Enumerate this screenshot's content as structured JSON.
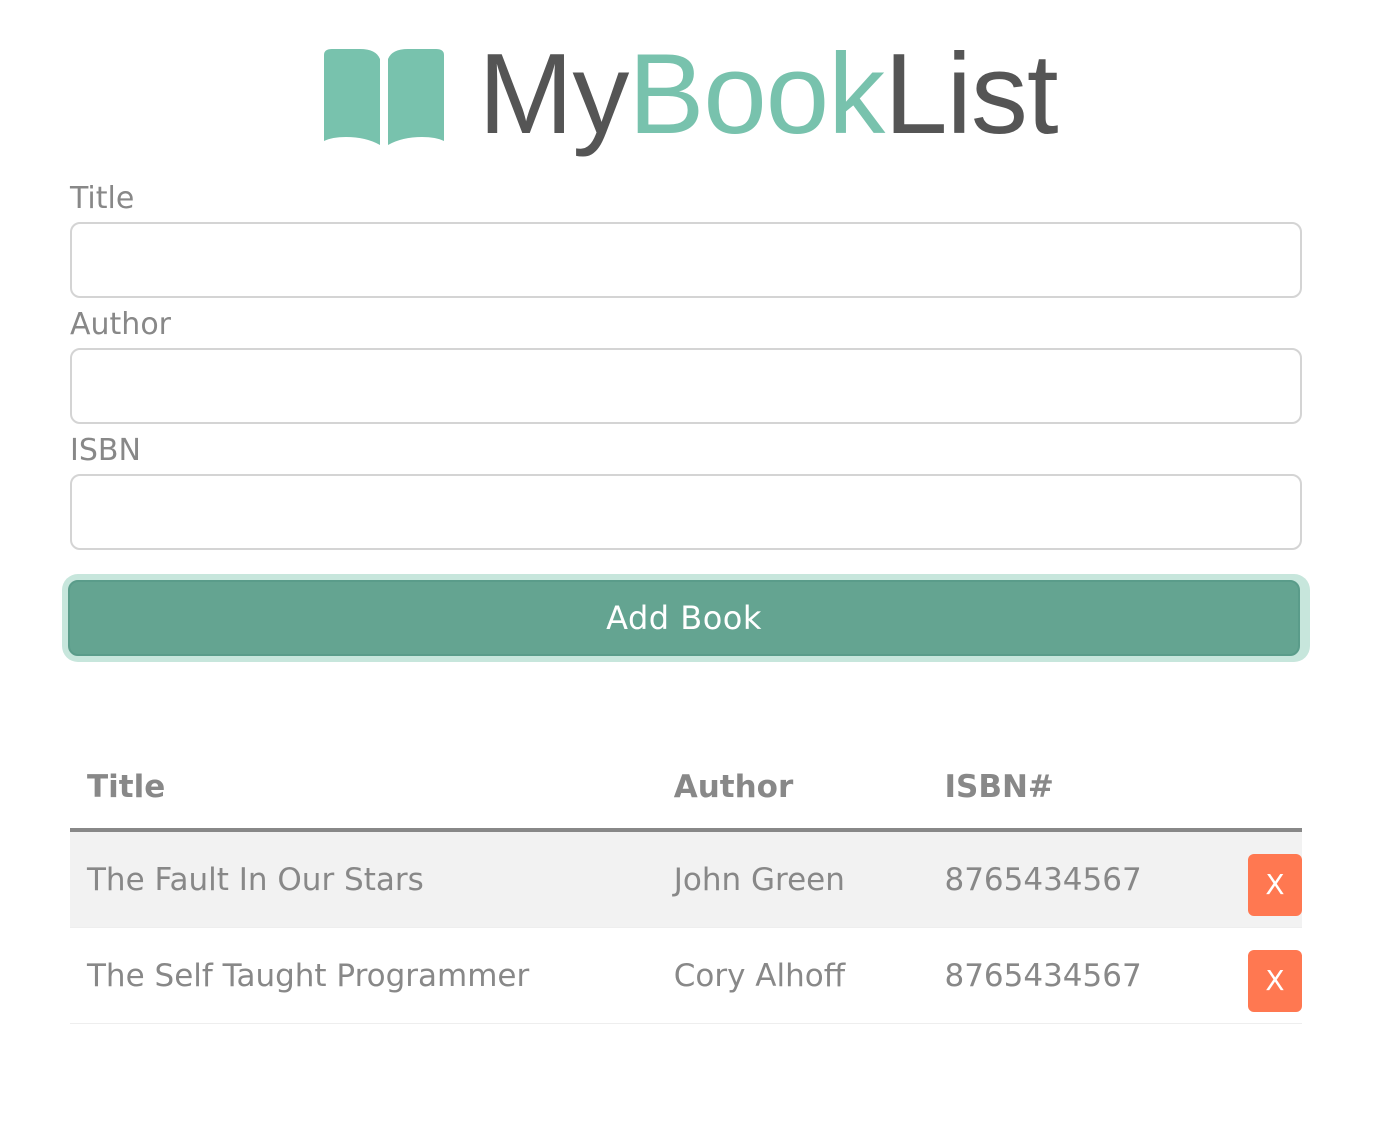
{
  "header": {
    "brand_part1": "My",
    "brand_part2": "Book",
    "brand_part3": "List",
    "logo_icon": "open-book-icon",
    "accent_color": "#78c2ad",
    "dark_color": "#555555"
  },
  "form": {
    "title_label": "Title",
    "title_value": "",
    "author_label": "Author",
    "author_value": "",
    "isbn_label": "ISBN",
    "isbn_value": "",
    "submit_label": "Add Book",
    "submit_color": "#64a491"
  },
  "table": {
    "headers": {
      "title": "Title",
      "author": "Author",
      "isbn": "ISBN#"
    },
    "rows": [
      {
        "title": "The Fault In Our Stars",
        "author": "John Green",
        "isbn": "8765434567",
        "delete_label": "X"
      },
      {
        "title": "The Self Taught Programmer",
        "author": "Cory Alhoff",
        "isbn": "8765434567",
        "delete_label": "X"
      }
    ],
    "delete_color": "#ff7851"
  }
}
